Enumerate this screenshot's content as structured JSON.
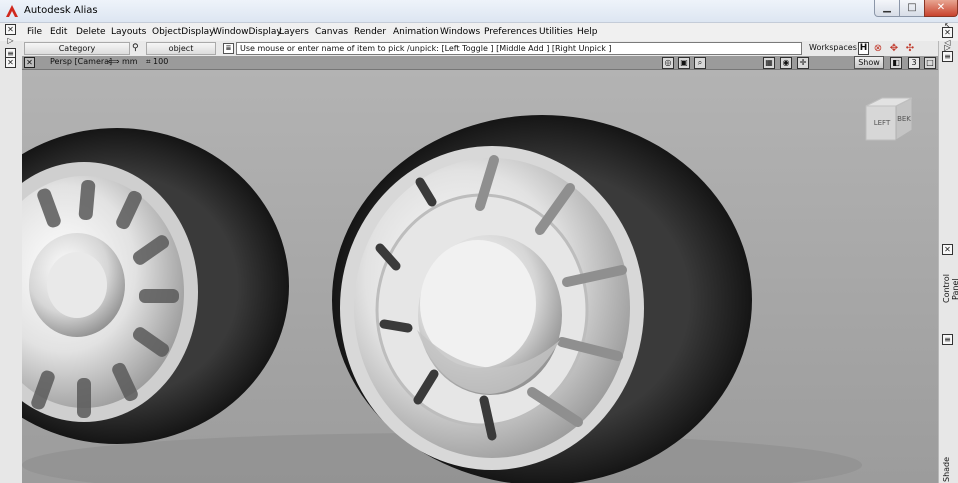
{
  "window": {
    "title": "Autodesk Alias",
    "minimize_glyph": "▁",
    "maximize_glyph": "□",
    "close_glyph": "✕"
  },
  "menu": {
    "items": [
      "File",
      "Edit",
      "Delete",
      "Layouts",
      "ObjectDisplay",
      "WindowDisplay",
      "Layers",
      "Canvas",
      "Render",
      "Animation",
      "Windows",
      "Preferences",
      "Utilities",
      "Help"
    ]
  },
  "prompt": {
    "category": "Category",
    "object": "object",
    "text": "Use mouse or enter name of item to pick /unpick: [Left Toggle ] [Middle Add ] [Right Unpick ]",
    "workspaces": "Workspaces",
    "workspaces_icon": "H"
  },
  "viewport": {
    "label": "Persp [Camera]",
    "units": "⟺ mm",
    "grid": "⌗ 100",
    "show": "Show",
    "view_count": "3"
  },
  "viewcube": {
    "left": "LEFT",
    "right": "BEK"
  },
  "side_panels": {
    "control_panel": "Control Panel",
    "shade": "Shade"
  },
  "colors": {
    "accent": "#c0392b",
    "viewport_bg": "#a7a7a7",
    "tire": "#1f1f1f"
  }
}
